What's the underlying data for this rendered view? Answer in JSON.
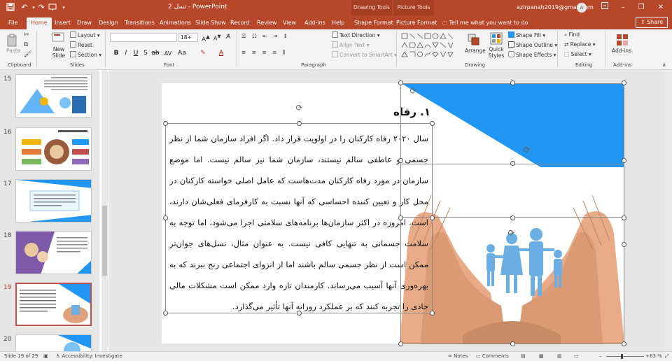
{
  "window": {
    "doc_title": "تسل 2 - PowerPoint",
    "context_groups": [
      "Drawing Tools",
      "Picture Tools"
    ],
    "user_email": "azirpanah2019@gmail.com",
    "avatar_initial": "A"
  },
  "tabs": [
    "File",
    "Home",
    "Insert",
    "Draw",
    "Design",
    "Transitions",
    "Animations",
    "Slide Show",
    "Record",
    "Review",
    "View",
    "Add-ins",
    "Help",
    "Shape Format",
    "Picture Format"
  ],
  "active_tab": "Home",
  "tell_me": "Tell me what you want to do",
  "share": "Share",
  "ribbon": {
    "clipboard": {
      "paste": "Paste",
      "label": "Clipboard"
    },
    "slides": {
      "new_slide": "New Slide",
      "layout": "Layout",
      "reset": "Reset",
      "section": "Section",
      "label": "Slides"
    },
    "font": {
      "name_value": "",
      "size_value": "18+",
      "label": "Font"
    },
    "paragraph": {
      "text_direction": "Text Direction",
      "align_text": "Align Text",
      "convert": "Convert to SmartArt",
      "label": "Paragraph"
    },
    "drawing": {
      "arrange": "Arrange",
      "quick_styles": "Quick Styles",
      "shape_fill": "Shape Fill",
      "shape_outline": "Shape Outline",
      "shape_effects": "Shape Effects",
      "label": "Drawing"
    },
    "editing": {
      "find": "Find",
      "replace": "Replace",
      "select": "Select",
      "label": "Editing"
    },
    "addins": {
      "addins": "Add-ins",
      "label": "Add-ins"
    }
  },
  "thumbnails": [
    {
      "num": "15"
    },
    {
      "num": "16"
    },
    {
      "num": "17"
    },
    {
      "num": "18"
    },
    {
      "num": "19"
    },
    {
      "num": "20"
    }
  ],
  "active_slide": "19",
  "slide": {
    "heading": "۱. رفاه",
    "body": "سال ۲۰۲۰ رفاه کارکنان را در اولویت قرار داد. اگر افراد سازمان شما از نظر جسمی و عاطفی سالم نیستند، سازمان شما نیز سالم نیست. اما موضع سازمان در مورد رفاه کارکنان مدت‌هاست که عامل اصلی خواسته کارکنان در محل کار و تعیین کننده احساسی که آنها نسبت به کارفرمای فعلی‌شان دارند، است. امروزه در اکثر سازمان‌ها برنامه‌های سلامتی اجرا می‌شود، اما توجه به سلامت جسمانی به تنهایی کافی نیست. به عنوان مثال، نسل‌های جوان‌تر ممکن است از نظر جسمی سالم باشند اما از انزوای اجتماعی رنج ببرند که به بهره‌وری آنها آسیب می‌رساند. کارمندان تازه وارد ممکن است مشکلات مالی حادی را تجربه کنند که بر عملکرد روزانه آنها تأثیر می‌گذارد.",
    "accent_color": "#2196f3"
  },
  "status": {
    "slide_of": "Slide 19 of 29",
    "accessibility": "Accessibility: Investigate",
    "notes": "Notes",
    "comments": "Comments",
    "zoom": "83 %"
  }
}
